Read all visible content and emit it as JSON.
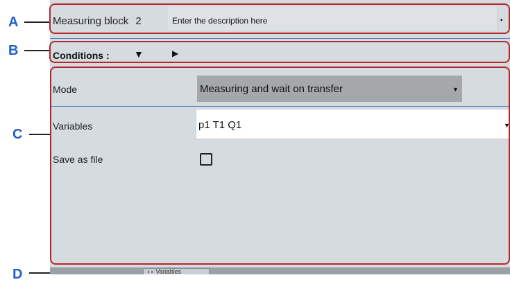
{
  "callouts": {
    "a": "A",
    "b": "B",
    "c": "C",
    "d": "D"
  },
  "block": {
    "title": "Measuring block",
    "number": "2",
    "description_placeholder": "Enter the description here"
  },
  "conditions": {
    "label": "Conditions :",
    "expand_icon": "triangle-down-icon",
    "collapse_icon": "triangle-right-icon"
  },
  "mode": {
    "label": "Mode",
    "value": "Measuring and wait on transfer"
  },
  "variables": {
    "label": "Variables",
    "value": "p1 T1 Q1"
  },
  "save": {
    "label": "Save as file",
    "checked": false
  },
  "tabs": [
    {
      "label": "Variables",
      "icon": "variables-icon"
    }
  ],
  "colors": {
    "callout": "#1f5fc6",
    "highlight_border": "#b3262b",
    "divider": "#4a7fc0",
    "panel_bg": "#d6dbdf"
  }
}
